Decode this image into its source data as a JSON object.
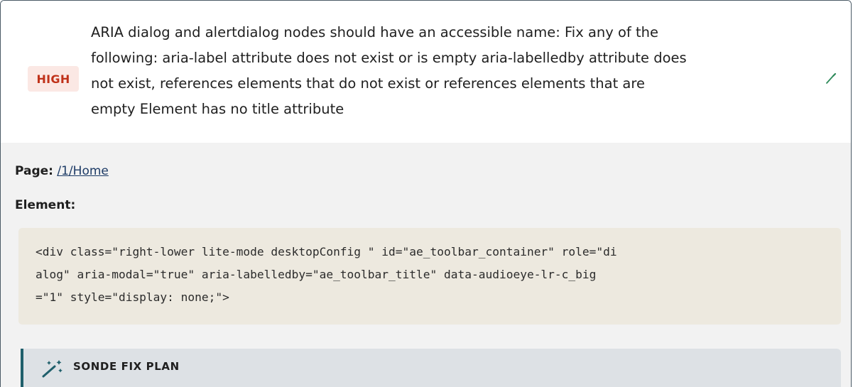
{
  "issue": {
    "severity": "HIGH",
    "title_lines": [
      "ARIA dialog and alertdialog nodes should have an accessible name: Fix any of the",
      "following: aria-label attribute does not exist or is empty aria-labelledby attribute does",
      "not exist, references elements that do not exist or references elements that are",
      "empty Element has no title attribute"
    ],
    "quick_fix_icon": "magic-wand-icon"
  },
  "details": {
    "page_label": "Page:",
    "page_link": "/1/Home",
    "element_label": "Element:",
    "code_lines": [
      "<div class=\"right-lower lite-mode desktopConfig \" id=\"ae_toolbar_container\" role=\"di",
      "alog\" aria-modal=\"true\" aria-labelledby=\"ae_toolbar_title\" data-audioeye-lr-c_big",
      "=\"1\" style=\"display: none;\">"
    ]
  },
  "fix_plan": {
    "label": "SONDE FIX PLAN",
    "icon": "magic-wand-sparkles-icon"
  },
  "colors": {
    "severity_text": "#c0321a",
    "severity_bg": "#fbe8e4",
    "accent": "#1f5f6b",
    "link": "#1d3b66",
    "code_bg": "#ede9df",
    "details_bg": "#f2f2f2",
    "fix_plan_bg": "#dde1e5"
  }
}
